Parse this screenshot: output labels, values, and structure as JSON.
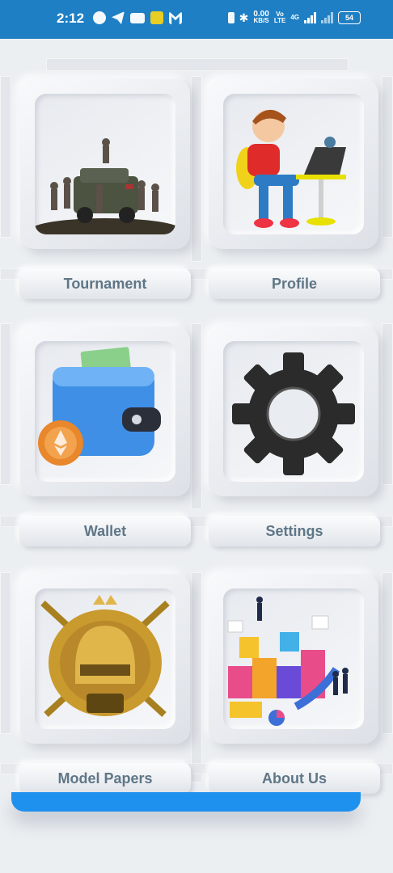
{
  "status_bar": {
    "time": "2:12",
    "network_speed": "0.00",
    "network_unit": "KB/S",
    "volte": "Vo",
    "lte": "LTE",
    "network_gen": "4G",
    "battery": "54",
    "icons": [
      "whatsapp-icon",
      "telegram-icon",
      "youtube-icon",
      "bo-icon",
      "gmail-icon",
      "vibrate-icon",
      "bluetooth-icon",
      "signal-icon"
    ]
  },
  "menu": {
    "items": [
      {
        "label": "Tournament",
        "icon": "soldiers-jeep-icon"
      },
      {
        "label": "Profile",
        "icon": "boy-laptop-icon"
      },
      {
        "label": "Wallet",
        "icon": "wallet-coin-icon"
      },
      {
        "label": "Settings",
        "icon": "gear-icon"
      },
      {
        "label": "Model Papers",
        "icon": "helmet-emblem-icon"
      },
      {
        "label": "About Us",
        "icon": "team-graph-icon"
      }
    ]
  },
  "colors": {
    "status_bar": "#1f7fc4",
    "accent": "#1e90ee",
    "label_text": "#5f7686",
    "background": "#eceff2"
  }
}
